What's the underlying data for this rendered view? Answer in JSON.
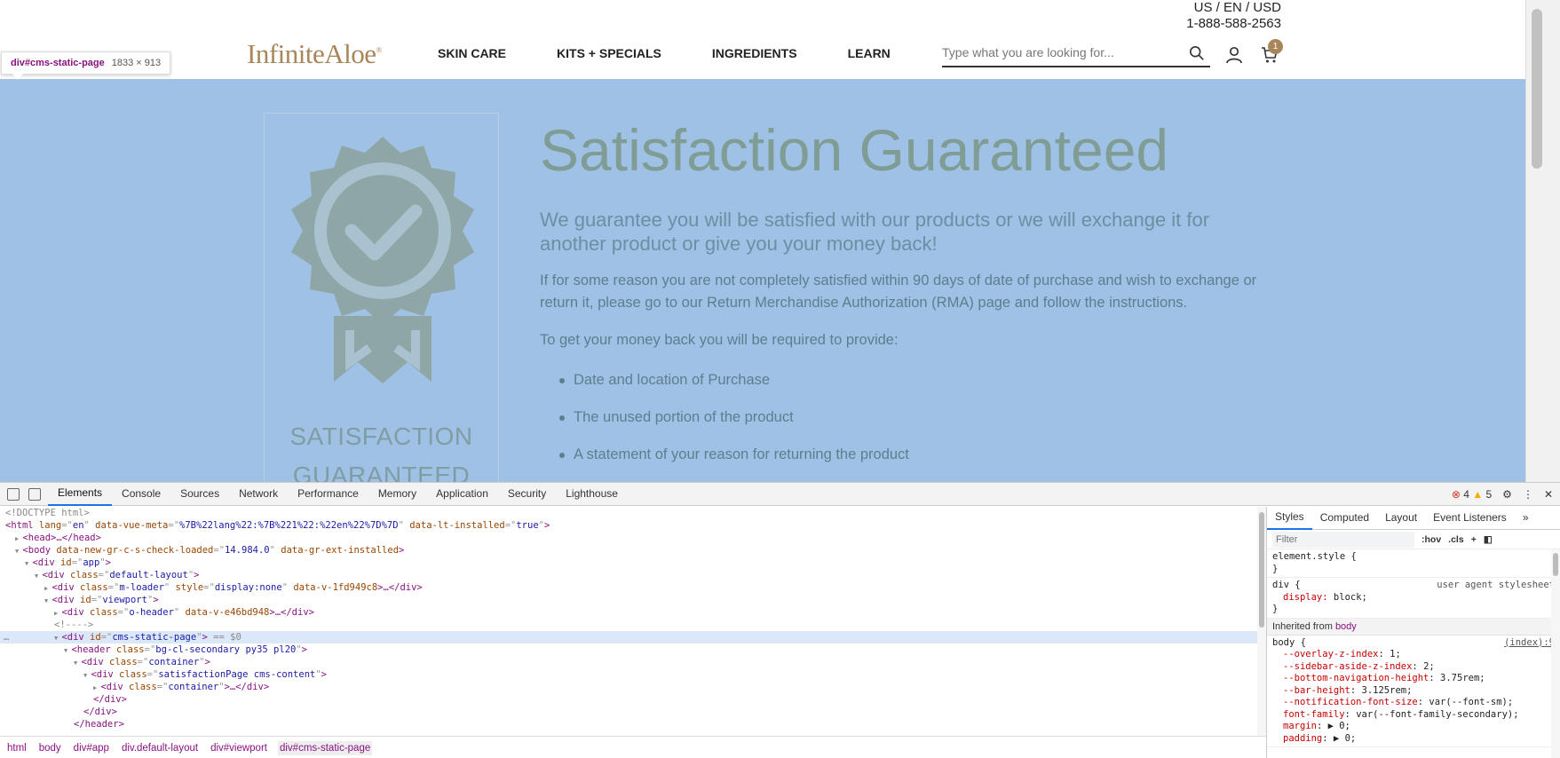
{
  "header": {
    "locale": "US / EN / USD",
    "phone": "1-888-588-2563",
    "logo_text": "InfiniteAloe",
    "logo_mark": "®",
    "nav": [
      {
        "label": "SKIN CARE"
      },
      {
        "label": "KITS + SPECIALS"
      },
      {
        "label": "INGREDIENTS"
      },
      {
        "label": "LEARN"
      }
    ],
    "search_placeholder": "Type what you are looking for...",
    "cart_count": "1"
  },
  "inspector_tooltip": {
    "tag": "div#cms-static-page",
    "dims": "1833 × 913"
  },
  "content": {
    "badge_caption_line1": "SATISFACTION",
    "badge_caption_line2": "GUARANTEED",
    "title": "Satisfaction Guaranteed",
    "lead": "We guarantee you will be satisfied with our products or we will exchange it for another product or give you your money back!",
    "paragraph": "If for some reason you are not completely satisfied within 90 days of date of purchase and wish to exchange or return it, please go to our Return Merchandise Authorization (RMA) page and follow the instructions.",
    "requirements_intro": "To get your money back you will be required to provide:",
    "requirements": [
      "Date and location of Purchase",
      "The unused portion of the product",
      "A statement of your reason for returning the product"
    ]
  },
  "devtools": {
    "tabs": [
      "Elements",
      "Console",
      "Sources",
      "Network",
      "Performance",
      "Memory",
      "Application",
      "Security",
      "Lighthouse"
    ],
    "active_tab": "Elements",
    "errors": "4",
    "warnings": "5",
    "dom_lines": [
      {
        "indent": 0,
        "arrow": "",
        "html": "<!DOCTYPE html>",
        "kind": "doctype"
      },
      {
        "indent": 0,
        "arrow": "",
        "tag": "html",
        "attrs": [
          [
            "lang",
            "en"
          ],
          [
            "data-vue-meta",
            "%7B%22lang%22:%7B%221%22:%22en%22%7D%7D"
          ],
          [
            "data-lt-installed",
            "true"
          ]
        ],
        "close": ">"
      },
      {
        "indent": 1,
        "arrow": "▶",
        "tag": "head",
        "attrs": [],
        "close": ">…</head>"
      },
      {
        "indent": 1,
        "arrow": "▼",
        "tag": "body",
        "attrs": [
          [
            "data-new-gr-c-s-check-loaded",
            "14.984.0"
          ],
          [
            "data-gr-ext-installed",
            ""
          ]
        ],
        "close": ">"
      },
      {
        "indent": 2,
        "arrow": "▼",
        "tag": "div",
        "attrs": [
          [
            "id",
            "app"
          ]
        ],
        "close": ">"
      },
      {
        "indent": 3,
        "arrow": "▼",
        "tag": "div",
        "attrs": [
          [
            "class",
            "default-layout"
          ]
        ],
        "close": ">"
      },
      {
        "indent": 4,
        "arrow": "▶",
        "tag": "div",
        "attrs": [
          [
            "class",
            "m-loader"
          ],
          [
            "style",
            "display:none"
          ],
          [
            "data-v-1fd949c8",
            ""
          ]
        ],
        "close": ">…</div>"
      },
      {
        "indent": 4,
        "arrow": "▼",
        "tag": "div",
        "attrs": [
          [
            "id",
            "viewport"
          ]
        ],
        "close": ">"
      },
      {
        "indent": 5,
        "arrow": "▶",
        "tag": "div",
        "attrs": [
          [
            "class",
            "o-header"
          ],
          [
            "data-v-e46bd948",
            ""
          ]
        ],
        "close": ">…</div>"
      },
      {
        "indent": 5,
        "arrow": "",
        "html": "<!---->",
        "kind": "comment"
      },
      {
        "indent": 5,
        "arrow": "▼",
        "tag": "div",
        "attrs": [
          [
            "id",
            "cms-static-page"
          ]
        ],
        "close": ">",
        "selected": true,
        "suffix": " == $0"
      },
      {
        "indent": 6,
        "arrow": "▼",
        "tag": "header",
        "attrs": [
          [
            "class",
            "bg-cl-secondary py35 pl20"
          ]
        ],
        "close": ">"
      },
      {
        "indent": 7,
        "arrow": "▼",
        "tag": "div",
        "attrs": [
          [
            "class",
            "container"
          ]
        ],
        "close": ">"
      },
      {
        "indent": 8,
        "arrow": "▼",
        "tag": "div",
        "attrs": [
          [
            "class",
            "satisfactionPage cms-content"
          ]
        ],
        "close": ">"
      },
      {
        "indent": 9,
        "arrow": "▶",
        "tag": "div",
        "attrs": [
          [
            "class",
            "container"
          ]
        ],
        "close": ">…</div>"
      },
      {
        "indent": 9,
        "arrow": "",
        "html": "</div>",
        "kind": "closetag"
      },
      {
        "indent": 8,
        "arrow": "",
        "html": "</div>",
        "kind": "closetag"
      },
      {
        "indent": 7,
        "arrow": "",
        "html": "</header>",
        "kind": "closetag"
      }
    ],
    "breadcrumbs": [
      "html",
      "body",
      "div#app",
      "div.default-layout",
      "div#viewport",
      "div#cms-static-page"
    ],
    "styles_tabs": [
      "Styles",
      "Computed",
      "Layout",
      "Event Listeners"
    ],
    "filter_placeholder": "Filter",
    "hov": ":hov",
    "cls": ".cls",
    "element_style": "element.style {",
    "ua_selector": "div {",
    "ua_source": "user agent stylesheet",
    "ua_prop": "display",
    "ua_val": "block;",
    "inherited_label": "Inherited from",
    "inherited_tag": "body",
    "body_source": "(index):9",
    "body_props": [
      [
        "--overlay-z-index",
        "1;"
      ],
      [
        "--sidebar-aside-z-index",
        "2;"
      ],
      [
        "--bottom-navigation-height",
        "3.75rem;"
      ],
      [
        "--bar-height",
        "3.125rem;"
      ],
      [
        "--notification-font-size",
        "var(--font-sm);"
      ],
      [
        "font-family",
        "var(--font-family-secondary);"
      ],
      [
        "margin",
        "▶ 0;"
      ],
      [
        "padding",
        "▶ 0;"
      ]
    ]
  }
}
